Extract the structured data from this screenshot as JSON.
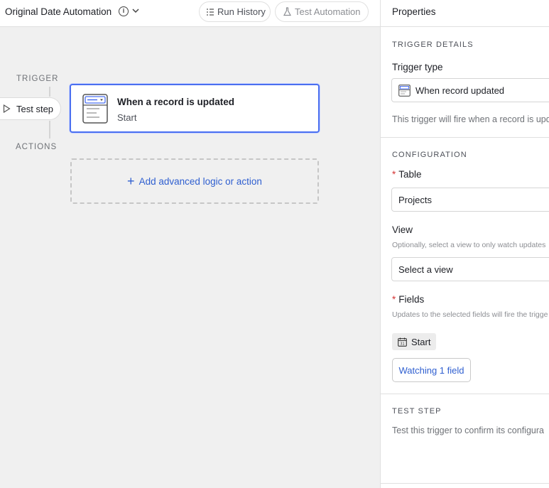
{
  "header": {
    "automation_name": "Original Date Automation",
    "run_history_label": "Run History",
    "test_automation_label": "Test Automation"
  },
  "canvas": {
    "trigger_label": "TRIGGER",
    "actions_label": "ACTIONS",
    "test_step_label": "Test step",
    "trigger_node": {
      "title": "When a record is updated",
      "subtitle": "Start"
    },
    "add_action_label": "Add advanced logic or action"
  },
  "properties": {
    "title": "Properties",
    "trigger_details_heading": "TRIGGER DETAILS",
    "trigger_type_label": "Trigger type",
    "trigger_type_value": "When record updated",
    "trigger_description": "This trigger will fire when a record is upd",
    "configuration_heading": "CONFIGURATION",
    "table_label": "Table",
    "table_value": "Projects",
    "view_label": "View",
    "view_hint": "Optionally, select a view to only watch updates",
    "view_placeholder": "Select a view",
    "fields_label": "Fields",
    "fields_hint": "Updates to the selected fields will fire the trigge",
    "field_chip": "Start",
    "watching_button": "Watching 1 field",
    "test_step_heading": "TEST STEP",
    "test_step_description": "Test this trigger to confirm its configura"
  },
  "colors": {
    "accent": "#4a6ff0",
    "link": "#2f5fd0",
    "required": "#d43434"
  }
}
